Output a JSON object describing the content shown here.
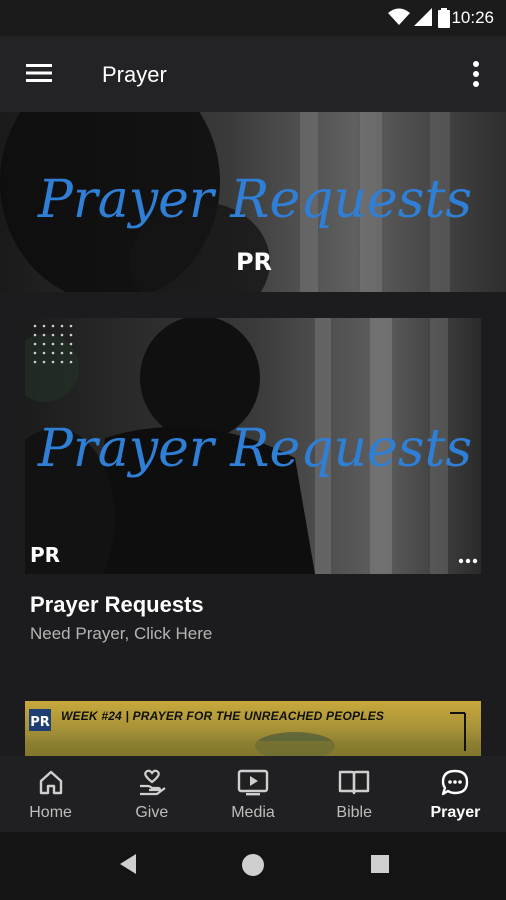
{
  "status": {
    "time": "10:26"
  },
  "app_bar": {
    "title": "Prayer"
  },
  "hero": {
    "script_text": "Prayer Requests",
    "logo": "PR"
  },
  "card": {
    "script_text": "Prayer Requests",
    "logo": "PR",
    "title": "Prayer Requests",
    "subtitle": "Need Prayer, Click Here"
  },
  "banner2": {
    "text": "WEEK #24 | PRAYER FOR THE UNREACHED PEOPLES",
    "logo": "PR"
  },
  "nav": {
    "items": [
      {
        "label": "Home",
        "icon": "home-icon"
      },
      {
        "label": "Give",
        "icon": "give-icon"
      },
      {
        "label": "Media",
        "icon": "media-icon"
      },
      {
        "label": "Bible",
        "icon": "bible-icon"
      },
      {
        "label": "Prayer",
        "icon": "prayer-icon",
        "active": true
      }
    ]
  },
  "colors": {
    "accent": "#2f7fd6",
    "background": "#1c1c1e",
    "nav_bg": "#202022"
  }
}
